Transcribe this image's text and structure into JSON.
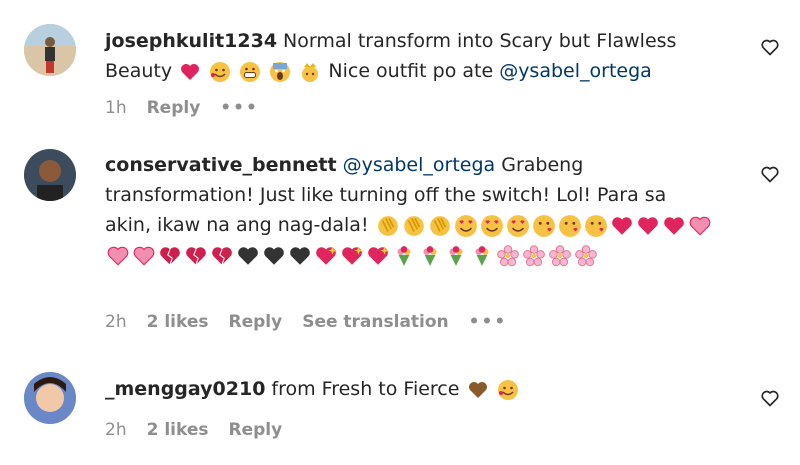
{
  "comments": [
    {
      "username": "josephkulit1234",
      "text_before": "Normal transform into Scary but Flawless Beauty",
      "emojis_mid": [
        "red-heart",
        "smiling-face-hearts",
        "grinning-face",
        "screaming-face",
        "princess"
      ],
      "text_after": "Nice outfit po ate",
      "mention": "@ysabel_ortega",
      "time": "1h",
      "likes": "",
      "reply": "Reply",
      "translation": "",
      "more": "•••"
    },
    {
      "username": "conservative_bennett",
      "mention": "@ysabel_ortega",
      "text": "Grabeng transformation! Just like turning off the switch! Lol! Para sa akin, ikaw na ang nag-dala!",
      "emojis": [
        "clap",
        "clap",
        "clap",
        "heart-eyes",
        "heart-eyes",
        "heart-eyes",
        "kiss",
        "kiss",
        "kiss",
        "red-heart",
        "red-heart",
        "red-heart",
        "pink-heart",
        "pink-heart",
        "pink-heart",
        "broken-heart",
        "broken-heart",
        "broken-heart",
        "black-heart",
        "black-heart",
        "black-heart",
        "heart-sparkle",
        "heart-sparkle",
        "heart-sparkle",
        "bouquet",
        "bouquet",
        "bouquet",
        "bouquet",
        "cherry-blossom",
        "cherry-blossom",
        "cherry-blossom",
        "cherry-blossom"
      ],
      "time": "2h",
      "likes": "2 likes",
      "reply": "Reply",
      "translation": "See translation",
      "more": "•••"
    },
    {
      "username": "_menggay0210",
      "text": "from Fresh to Fierce",
      "emojis": [
        "brown-heart",
        "smiling-face-hearts"
      ],
      "time": "2h",
      "likes": "2 likes",
      "reply": "Reply",
      "translation": "",
      "more": ""
    }
  ],
  "colors": {
    "text": "#262626",
    "meta": "#8e8e8e",
    "mention": "#00376b"
  }
}
